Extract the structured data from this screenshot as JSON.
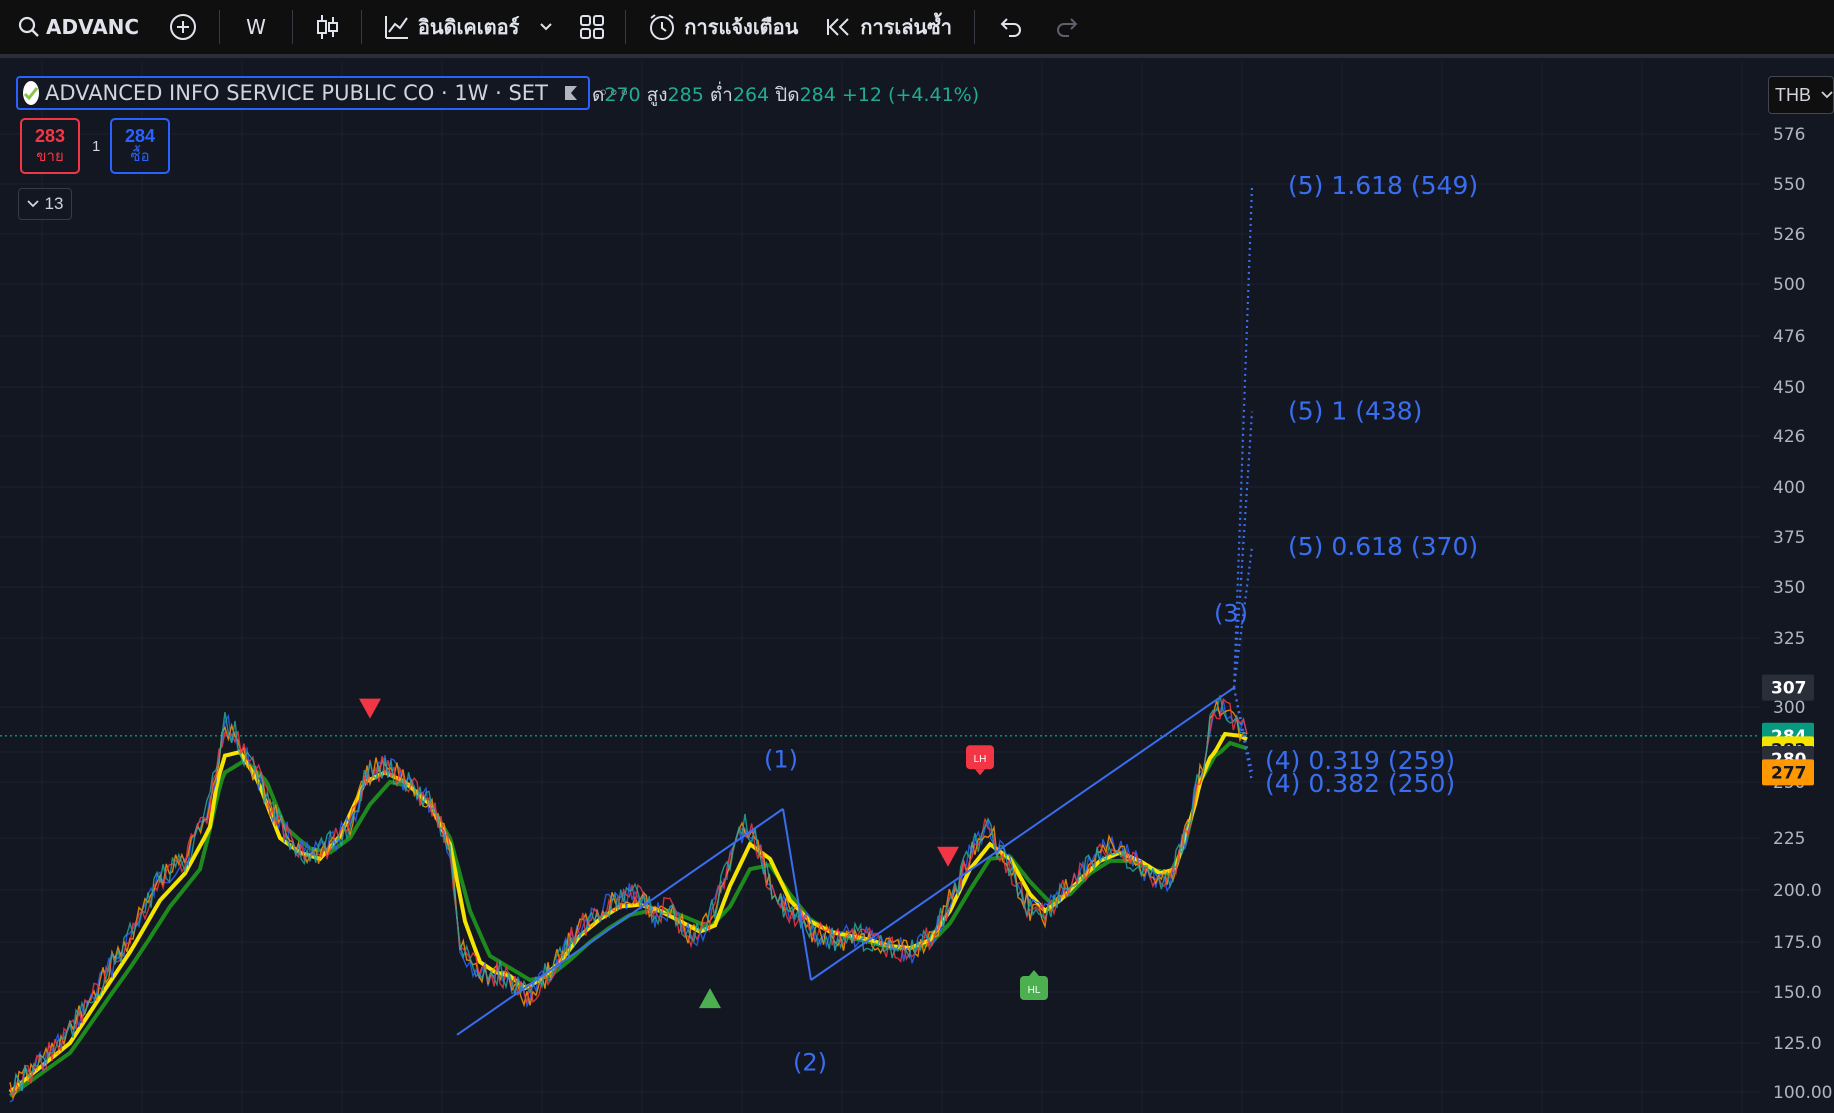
{
  "toolbar": {
    "symbol": "ADVANC",
    "interval": "W",
    "indicators_label": "อินดิเคเตอร์",
    "alerts_label": "การแจ้งเตือน",
    "replay_label": "การเล่นซ้ำ",
    "icons": [
      "search-icon",
      "add-symbol-icon",
      "candles-icon",
      "indicators-icon",
      "chevron-down-icon",
      "layouts-icon",
      "alert-clock-icon",
      "replay-icon",
      "undo-icon",
      "redo-icon"
    ]
  },
  "legend": {
    "title": "ADVANCED INFO SERVICE PUBLIC CO · 1W · SET",
    "dots": "◦◦◦",
    "open_label": "ด",
    "open": "270",
    "high_label": "สูง",
    "high": "285",
    "low_label": "ต่ำ",
    "low": "264",
    "close_label": "ปิด",
    "close": "284",
    "change": "+12 (+4.41%)"
  },
  "trade": {
    "sell_price": "283",
    "sell_label": "ขาย",
    "qty": "1",
    "buy_price": "284",
    "buy_label": "ซื้อ",
    "indicator_count": "13"
  },
  "currency": "THB",
  "colors": {
    "background": "#131722",
    "up": "#22ab94",
    "accent_blue": "#2962ff",
    "wave_blue": "#3a6ef0",
    "ema_fast": "#f5e400",
    "ema_slow": "#1e8a1e",
    "sell": "#f23645"
  },
  "chart_data": {
    "type": "line",
    "description_series": "weekly price path (approximate)",
    "y_ticks": [
      "576",
      "550",
      "526",
      "500",
      "476",
      "450",
      "426",
      "400",
      "375",
      "350",
      "325",
      "300",
      "275",
      "250",
      "225",
      "200.0",
      "175.0",
      "150.0",
      "125.0",
      "100.00"
    ],
    "price_tags": [
      {
        "label": "307",
        "color": "#2a2e39",
        "text": "#ffffff"
      },
      {
        "label": "284",
        "color": "#089981",
        "text": "#ffffff"
      },
      {
        "label": "282",
        "color": "#f5e400",
        "text": "#131722"
      },
      {
        "label": "280",
        "color": "#2a2e39",
        "text": "#ffffff"
      },
      {
        "label": "277",
        "color": "#ff9800",
        "text": "#131722"
      }
    ],
    "series": [
      {
        "points": [
          [
            0,
            100
          ],
          [
            60,
            130
          ],
          [
            120,
            178
          ],
          [
            150,
            205
          ],
          [
            175,
            215
          ],
          [
            200,
            240
          ],
          [
            215,
            290
          ],
          [
            225,
            285
          ],
          [
            240,
            265
          ],
          [
            260,
            238
          ],
          [
            280,
            225
          ],
          [
            300,
            215
          ],
          [
            320,
            222
          ],
          [
            340,
            230
          ],
          [
            360,
            258
          ],
          [
            375,
            262
          ],
          [
            390,
            255
          ],
          [
            410,
            245
          ],
          [
            425,
            238
          ],
          [
            440,
            220
          ],
          [
            450,
            172
          ],
          [
            460,
            165
          ],
          [
            475,
            158
          ],
          [
            490,
            160
          ],
          [
            505,
            152
          ],
          [
            520,
            148
          ],
          [
            535,
            158
          ],
          [
            550,
            168
          ],
          [
            570,
            182
          ],
          [
            590,
            190
          ],
          [
            605,
            195
          ],
          [
            625,
            198
          ],
          [
            645,
            188
          ],
          [
            660,
            192
          ],
          [
            675,
            180
          ],
          [
            690,
            178
          ],
          [
            705,
            192
          ],
          [
            720,
            215
          ],
          [
            735,
            230
          ],
          [
            745,
            225
          ],
          [
            765,
            195
          ],
          [
            785,
            188
          ],
          [
            805,
            180
          ],
          [
            825,
            175
          ],
          [
            845,
            178
          ],
          [
            865,
            175
          ],
          [
            885,
            172
          ],
          [
            905,
            170
          ],
          [
            925,
            180
          ],
          [
            945,
            200
          ],
          [
            965,
            222
          ],
          [
            975,
            230
          ],
          [
            990,
            220
          ],
          [
            1005,
            205
          ],
          [
            1020,
            190
          ],
          [
            1035,
            188
          ],
          [
            1050,
            198
          ],
          [
            1070,
            208
          ],
          [
            1090,
            218
          ],
          [
            1105,
            222
          ],
          [
            1120,
            215
          ],
          [
            1140,
            208
          ],
          [
            1160,
            205
          ],
          [
            1175,
            225
          ],
          [
            1190,
            255
          ],
          [
            1200,
            290
          ],
          [
            1210,
            300
          ],
          [
            1220,
            295
          ],
          [
            1230,
            288
          ],
          [
            1237,
            285
          ]
        ]
      },
      {
        "points": [
          [
            0,
            100
          ],
          [
            60,
            125
          ],
          [
            120,
            170
          ],
          [
            150,
            195
          ],
          [
            175,
            208
          ],
          [
            200,
            230
          ],
          [
            215,
            272
          ],
          [
            230,
            275
          ],
          [
            250,
            248
          ],
          [
            270,
            225
          ],
          [
            290,
            218
          ],
          [
            310,
            215
          ],
          [
            330,
            226
          ],
          [
            355,
            250
          ],
          [
            375,
            258
          ],
          [
            395,
            250
          ],
          [
            420,
            240
          ],
          [
            440,
            222
          ],
          [
            455,
            185
          ],
          [
            470,
            165
          ],
          [
            485,
            160
          ],
          [
            500,
            158
          ],
          [
            515,
            152
          ],
          [
            530,
            156
          ],
          [
            550,
            165
          ],
          [
            570,
            178
          ],
          [
            590,
            186
          ],
          [
            610,
            192
          ],
          [
            630,
            193
          ],
          [
            650,
            190
          ],
          [
            670,
            185
          ],
          [
            690,
            180
          ],
          [
            705,
            183
          ],
          [
            720,
            202
          ],
          [
            740,
            222
          ],
          [
            760,
            215
          ],
          [
            780,
            195
          ],
          [
            800,
            185
          ],
          [
            820,
            180
          ],
          [
            840,
            178
          ],
          [
            860,
            176
          ],
          [
            880,
            173
          ],
          [
            900,
            172
          ],
          [
            920,
            176
          ],
          [
            940,
            190
          ],
          [
            960,
            210
          ],
          [
            980,
            222
          ],
          [
            1000,
            215
          ],
          [
            1020,
            198
          ],
          [
            1035,
            190
          ],
          [
            1050,
            195
          ],
          [
            1070,
            205
          ],
          [
            1090,
            214
          ],
          [
            1110,
            218
          ],
          [
            1130,
            214
          ],
          [
            1150,
            208
          ],
          [
            1165,
            210
          ],
          [
            1185,
            240
          ],
          [
            1200,
            270
          ],
          [
            1215,
            285
          ],
          [
            1230,
            284
          ],
          [
            1237,
            282
          ]
        ]
      },
      {
        "points": [
          [
            0,
            98
          ],
          [
            60,
            120
          ],
          [
            120,
            162
          ],
          [
            160,
            192
          ],
          [
            190,
            210
          ],
          [
            215,
            258
          ],
          [
            235,
            268
          ],
          [
            255,
            252
          ],
          [
            275,
            230
          ],
          [
            300,
            220
          ],
          [
            320,
            218
          ],
          [
            340,
            225
          ],
          [
            360,
            240
          ],
          [
            380,
            250
          ],
          [
            400,
            248
          ],
          [
            420,
            240
          ],
          [
            440,
            225
          ],
          [
            460,
            190
          ],
          [
            480,
            168
          ],
          [
            500,
            162
          ],
          [
            520,
            156
          ],
          [
            540,
            158
          ],
          [
            560,
            166
          ],
          [
            580,
            175
          ],
          [
            600,
            182
          ],
          [
            620,
            188
          ],
          [
            640,
            190
          ],
          [
            660,
            190
          ],
          [
            680,
            186
          ],
          [
            700,
            182
          ],
          [
            720,
            192
          ],
          [
            740,
            210
          ],
          [
            760,
            212
          ],
          [
            780,
            198
          ],
          [
            800,
            186
          ],
          [
            820,
            180
          ],
          [
            840,
            177
          ],
          [
            860,
            175
          ],
          [
            880,
            172
          ],
          [
            900,
            172
          ],
          [
            920,
            174
          ],
          [
            940,
            184
          ],
          [
            960,
            200
          ],
          [
            980,
            215
          ],
          [
            1000,
            216
          ],
          [
            1020,
            204
          ],
          [
            1040,
            194
          ],
          [
            1060,
            198
          ],
          [
            1080,
            208
          ],
          [
            1100,
            214
          ],
          [
            1120,
            214
          ],
          [
            1140,
            210
          ],
          [
            1160,
            208
          ],
          [
            1175,
            222
          ],
          [
            1190,
            250
          ],
          [
            1205,
            272
          ],
          [
            1220,
            280
          ],
          [
            1237,
            277
          ]
        ]
      }
    ],
    "waves": {
      "lines": [
        [
          [
            447,
            129
          ],
          [
            773,
            238
          ]
        ],
        [
          [
            773,
            238
          ],
          [
            801,
            156
          ]
        ],
        [
          [
            801,
            156
          ],
          [
            1224,
            307
          ]
        ]
      ],
      "labels": [
        {
          "text": "(1)",
          "x": 771,
          "y": 262
        },
        {
          "text": "(2)",
          "x": 800,
          "y": 111
        },
        {
          "text": "(3)",
          "x": 1221,
          "y": 333
        }
      ]
    },
    "fib_targets": [
      {
        "text": "(5) 1.618 (549)",
        "price": 549
      },
      {
        "text": "(5) 1 (438)",
        "price": 438
      },
      {
        "text": "(5) 0.618 (370)",
        "price": 370
      },
      {
        "text": "(4) 0.319 (259)",
        "price": 259
      },
      {
        "text": "(4) 0.382 (250)",
        "price": 250
      }
    ],
    "markers": [
      {
        "type": "down-triangle",
        "x": 360,
        "price": 298,
        "color": "#f23645"
      },
      {
        "type": "up-triangle",
        "x": 700,
        "price": 148,
        "color": "#4caf50"
      },
      {
        "type": "down-triangle",
        "x": 938,
        "price": 215,
        "color": "#f23645"
      },
      {
        "type": "label-down",
        "x": 970,
        "price": 269,
        "text": "LH",
        "color": "#f23645"
      },
      {
        "type": "label-up",
        "x": 1024,
        "price": 153,
        "text": "HL",
        "color": "#4caf50"
      }
    ],
    "current_price": 284,
    "ylim": [
      96,
      585
    ]
  }
}
